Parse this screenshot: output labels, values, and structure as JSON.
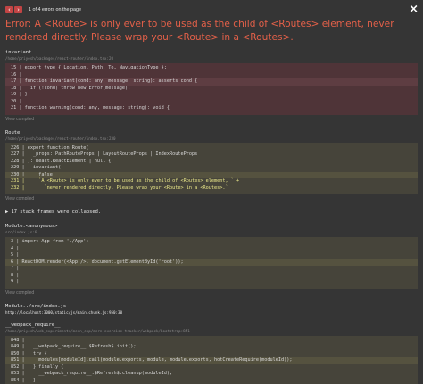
{
  "header": {
    "prev_icon": "chevron-left",
    "next_icon": "chevron-right",
    "error_count": "1 of 4 errors on the page",
    "close_icon": "×"
  },
  "title": "Error: A <Route> is only ever to be used as the child of <Routes> element, never rendered directly. Please wrap your <Route> in a <Routes>.",
  "frames": [
    {
      "name": "invariant",
      "path": "/home/priyesh/packages/react-router/index.tsx:20",
      "lines": [
        "15 | export type { Location, Path, To, NavigationType };",
        "16 |",
        "17 | function invariant(cond: any, message: string): asserts cond {",
        "18 |   if (!cond) throw new Error(message);",
        "19 | }",
        "20 |",
        "21 | function warning(cond: any, message: string): void {"
      ],
      "view": "View compiled"
    },
    {
      "name": "Route",
      "path": "/home/priyesh/packages/react-router/index.tsx:230",
      "lines": [
        "226 | export function Route(",
        "227 |   _props: PathRouteProps | LayoutRouteProps | IndexRouteProps",
        "228 | ): React.ReactElement | null {",
        "229 |   invariant(",
        "230 |     false,",
        "231 |     `A <Route> is only ever to be used as the child of <Routes> element, ` +",
        "232 |       `never rendered directly. Please wrap your <Route> in a <Routes>.`"
      ],
      "view": "View compiled"
    }
  ],
  "collapsed": "17 stack frames were collapsed.",
  "module_frame": {
    "name": "Module.<anonymous>",
    "path": "src/index.js:6",
    "lines": [
      "3 | import App from './App';",
      "4 |",
      "5 |",
      "6 | ReactDOM.render(<App />, document.getElementById('root'));",
      "7 |",
      "8 |",
      "9 |"
    ],
    "view": "View compiled"
  },
  "module_src": {
    "name": "Module../src/index.js",
    "url": "http://localhost:3000/static/js/main.chunk.js:950:30"
  },
  "webpack_frame": {
    "name": "__webpack_require__",
    "path": "/home/priyesh/web_experiments/mern_exp/mern-exercise-tracker/webpack/bootstrap:851",
    "lines": [
      "848 |",
      "849 |   __webpack_require__.$Refresh$.init();",
      "850 |   try {",
      "851 |     modules[moduleId].call(module.exports, module, module.exports, hotCreateRequire(moduleId));",
      "852 |   } finally {",
      "853 |     __webpack_require__.$Refresh$.cleanup(moduleId);",
      "854 |   }"
    ]
  }
}
